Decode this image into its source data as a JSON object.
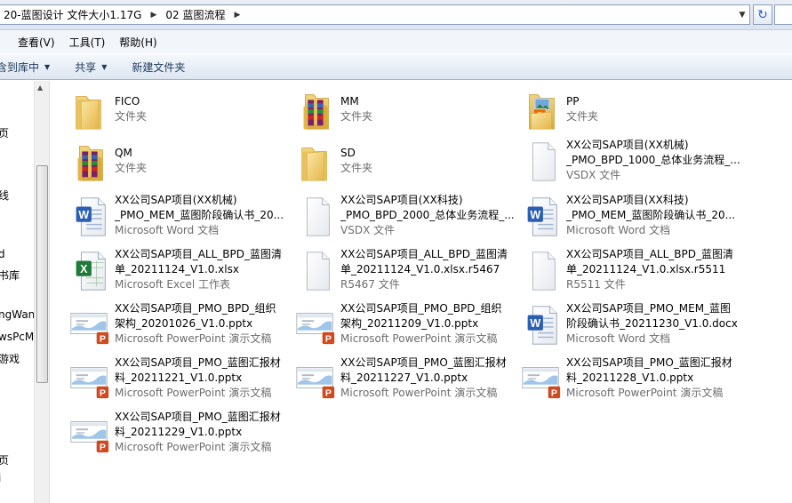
{
  "address": {
    "crumbs": [
      "20-蓝图设计 文件大小1.17G",
      "02 蓝图流程"
    ]
  },
  "menu": [
    "查看(V)",
    "工具(T)",
    "帮助(H)"
  ],
  "toolbar": {
    "include_library": "含到库中",
    "share": "共享",
    "new_folder": "新建文件夹"
  },
  "nav_fragments": [
    "页",
    "线",
    "d",
    "书库",
    "ngWan",
    "wsPcMa",
    "游戏",
    "页",
    "i"
  ],
  "files": [
    {
      "name1": "FICO",
      "name2": "",
      "type": "文件夹",
      "icon": "folder-icon"
    },
    {
      "name1": "MM",
      "name2": "",
      "type": "文件夹",
      "icon": "folder-archive-icon"
    },
    {
      "name1": "PP",
      "name2": "",
      "type": "文件夹",
      "icon": "folder-pictures-icon"
    },
    {
      "name1": "QM",
      "name2": "",
      "type": "文件夹",
      "icon": "folder-archive-icon"
    },
    {
      "name1": "SD",
      "name2": "",
      "type": "文件夹",
      "icon": "folder-icon"
    },
    {
      "name1": "XX公司SAP项目(XX机械)",
      "name2": "_PMO_BPD_1000_总体业务流程_...",
      "type": "VSDX 文件",
      "icon": "blank-file-icon"
    },
    {
      "name1": "XX公司SAP项目(XX机械)",
      "name2": "_PMO_MEM_蓝图阶段确认书_20...",
      "type": "Microsoft Word 文档",
      "icon": "word-doc-icon"
    },
    {
      "name1": "XX公司SAP项目(XX科技)",
      "name2": "_PMO_BPD_2000_总体业务流程_...",
      "type": "VSDX 文件",
      "icon": "blank-file-icon"
    },
    {
      "name1": "XX公司SAP项目(XX科技)",
      "name2": "_PMO_MEM_蓝图阶段确认书_20...",
      "type": "Microsoft Word 文档",
      "icon": "word-doc-icon"
    },
    {
      "name1": "XX公司SAP项目_ALL_BPD_蓝图清",
      "name2": "单_20211124_V1.0.xlsx",
      "type": "Microsoft Excel 工作表",
      "icon": "excel-sheet-icon"
    },
    {
      "name1": "XX公司SAP项目_ALL_BPD_蓝图清",
      "name2": "单_20211124_V1.0.xlsx.r5467",
      "type": "R5467 文件",
      "icon": "blank-file-icon"
    },
    {
      "name1": "XX公司SAP项目_ALL_BPD_蓝图清",
      "name2": "单_20211124_V1.0.xlsx.r5511",
      "type": "R5511 文件",
      "icon": "blank-file-icon"
    },
    {
      "name1": "XX公司SAP项目_PMO_BPD_组织",
      "name2": "架构_20201026_V1.0.pptx",
      "type": "Microsoft PowerPoint 演示文稿",
      "icon": "powerpoint-icon"
    },
    {
      "name1": "XX公司SAP项目_PMO_BPD_组织",
      "name2": "架构_20211209_V1.0.pptx",
      "type": "Microsoft PowerPoint 演示文稿",
      "icon": "powerpoint-icon"
    },
    {
      "name1": "XX公司SAP项目_PMO_MEM_蓝图",
      "name2": "阶段确认书_20211230_V1.0.docx",
      "type": "Microsoft Word 文档",
      "icon": "word-doc-icon"
    },
    {
      "name1": "XX公司SAP项目_PMO_蓝图汇报材",
      "name2": "料_20211221_V1.0.pptx",
      "type": "Microsoft PowerPoint 演示文稿",
      "icon": "powerpoint-icon"
    },
    {
      "name1": "XX公司SAP项目_PMO_蓝图汇报材",
      "name2": "料_20211227_V1.0.pptx",
      "type": "Microsoft PowerPoint 演示文稿",
      "icon": "powerpoint-icon"
    },
    {
      "name1": "XX公司SAP项目_PMO_蓝图汇报材",
      "name2": "料_20211228_V1.0.pptx",
      "type": "Microsoft PowerPoint 演示文稿",
      "icon": "powerpoint-icon"
    },
    {
      "name1": "XX公司SAP项目_PMO_蓝图汇报材",
      "name2": "料_20211229_V1.0.pptx",
      "type": "Microsoft PowerPoint 演示文稿",
      "icon": "powerpoint-icon"
    }
  ]
}
